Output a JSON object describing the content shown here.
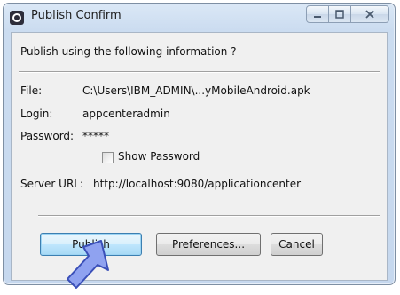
{
  "window": {
    "title": "Publish Confirm",
    "controls": [
      "minimize-icon",
      "maximize-icon",
      "close-icon"
    ]
  },
  "dialog": {
    "section_title": "Publish using the following information ?",
    "file_label": "File:",
    "file_value": "C:\\Users\\IBM_ADMIN\\...yMobileAndroid.apk",
    "login_label": "Login:",
    "login_value": "appcenteradmin",
    "password_label": "Password:",
    "password_value": "*****",
    "show_password_label": "Show Password",
    "show_password_checked": false,
    "server_label": "Server URL:",
    "server_value": "http://localhost:9080/applicationcenter"
  },
  "buttons": {
    "publish": "Publish",
    "preferences": "Preferences...",
    "cancel": "Cancel"
  },
  "colors": {
    "titlebar": "#cbdcf0",
    "client_bg": "#f0f0f0",
    "default_button": "#bee6fd",
    "pointer_arrow": "#8fa2f0"
  },
  "icons": {
    "app_icon": "eclipse-app-icon",
    "pointer": "arrow-pointer-icon"
  }
}
